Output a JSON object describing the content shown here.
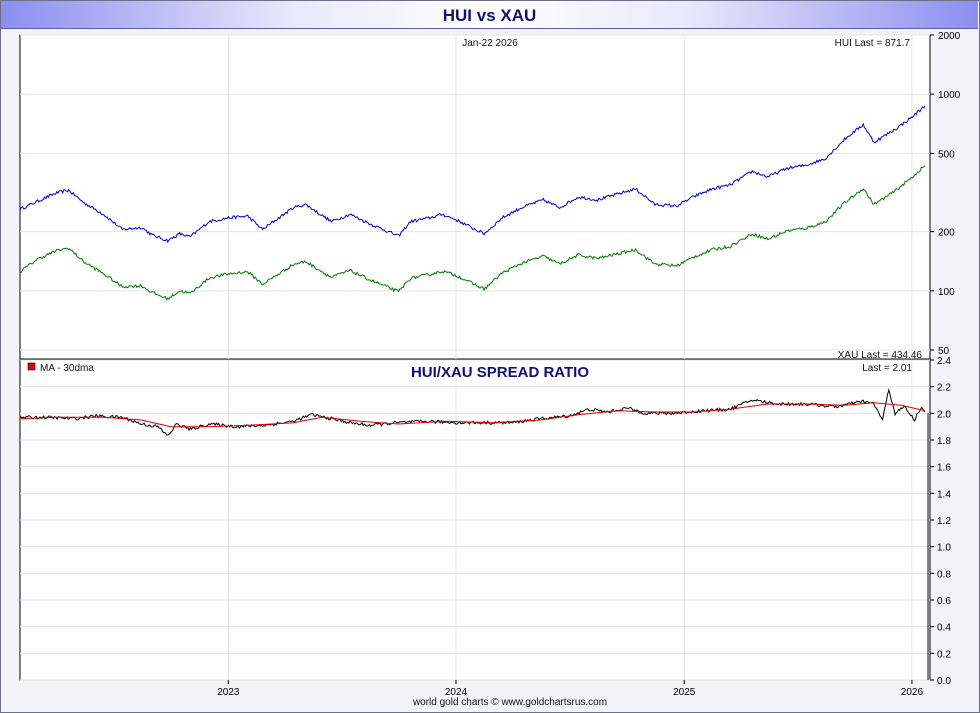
{
  "window": {
    "title": "HUI vs XAU"
  },
  "footer": {
    "credit": "world gold charts © www.goldchartsrus.com"
  },
  "chart_data": [
    {
      "type": "line",
      "panel": "top",
      "date_label": "Jan-22  2026",
      "hui_last_label": "HUI Last = 871.7",
      "xau_last_label": "XAU Last = 434.46",
      "y_scale": "log",
      "ylim": [
        45,
        2000
      ],
      "y_ticks": [
        50,
        100,
        200,
        500,
        1000,
        2000
      ],
      "y_tick_labels": [
        "50",
        "100",
        "200",
        "500",
        "1000",
        "2000"
      ],
      "x_tick_labels": [
        "2023",
        "2024",
        "2025",
        "2026"
      ],
      "series": [
        {
          "name": "HUI",
          "color": "#0000c8",
          "points": [
            [
              "2022-02-01",
              260
            ],
            [
              "2022-03-01",
              285
            ],
            [
              "2022-04-01",
              315
            ],
            [
              "2022-04-20",
              325
            ],
            [
              "2022-05-15",
              280
            ],
            [
              "2022-06-15",
              245
            ],
            [
              "2022-07-15",
              205
            ],
            [
              "2022-08-15",
              210
            ],
            [
              "2022-09-01",
              192
            ],
            [
              "2022-09-26",
              180
            ],
            [
              "2022-10-15",
              195
            ],
            [
              "2022-11-01",
              188
            ],
            [
              "2022-12-01",
              225
            ],
            [
              "2023-01-01",
              235
            ],
            [
              "2023-02-01",
              240
            ],
            [
              "2023-02-25",
              205
            ],
            [
              "2023-04-15",
              265
            ],
            [
              "2023-05-05",
              275
            ],
            [
              "2023-06-15",
              225
            ],
            [
              "2023-07-15",
              245
            ],
            [
              "2023-08-15",
              220
            ],
            [
              "2023-10-01",
              190
            ],
            [
              "2023-10-20",
              225
            ],
            [
              "2023-11-20",
              235
            ],
            [
              "2023-12-10",
              245
            ],
            [
              "2024-01-01",
              230
            ],
            [
              "2024-02-15",
              195
            ],
            [
              "2024-03-15",
              235
            ],
            [
              "2024-04-15",
              265
            ],
            [
              "2024-05-20",
              290
            ],
            [
              "2024-06-15",
              265
            ],
            [
              "2024-07-15",
              300
            ],
            [
              "2024-08-15",
              290
            ],
            [
              "2024-10-15",
              330
            ],
            [
              "2024-11-15",
              275
            ],
            [
              "2024-12-20",
              270
            ],
            [
              "2025-01-15",
              300
            ],
            [
              "2025-02-15",
              330
            ],
            [
              "2025-03-15",
              345
            ],
            [
              "2025-04-20",
              405
            ],
            [
              "2025-05-15",
              380
            ],
            [
              "2025-06-15",
              420
            ],
            [
              "2025-07-15",
              435
            ],
            [
              "2025-08-15",
              470
            ],
            [
              "2025-09-15",
              590
            ],
            [
              "2025-10-15",
              700
            ],
            [
              "2025-11-01",
              570
            ],
            [
              "2025-12-01",
              650
            ],
            [
              "2025-12-31",
              760
            ],
            [
              "2026-01-22",
              871.7
            ]
          ]
        },
        {
          "name": "XAU",
          "color": "#007800",
          "points": [
            [
              "2022-02-01",
              125
            ],
            [
              "2022-03-01",
              145
            ],
            [
              "2022-04-01",
              160
            ],
            [
              "2022-04-20",
              165
            ],
            [
              "2022-05-15",
              140
            ],
            [
              "2022-06-15",
              122
            ],
            [
              "2022-07-15",
              105
            ],
            [
              "2022-08-15",
              106
            ],
            [
              "2022-09-01",
              98
            ],
            [
              "2022-09-26",
              91
            ],
            [
              "2022-10-15",
              100
            ],
            [
              "2022-11-01",
              97
            ],
            [
              "2022-12-01",
              116
            ],
            [
              "2023-01-01",
              122
            ],
            [
              "2023-02-01",
              125
            ],
            [
              "2023-02-25",
              108
            ],
            [
              "2023-04-15",
              136
            ],
            [
              "2023-05-05",
              141
            ],
            [
              "2023-06-15",
              117
            ],
            [
              "2023-07-15",
              127
            ],
            [
              "2023-08-15",
              114
            ],
            [
              "2023-10-01",
              99
            ],
            [
              "2023-10-20",
              116
            ],
            [
              "2023-11-20",
              121
            ],
            [
              "2023-12-10",
              126
            ],
            [
              "2024-01-01",
              120
            ],
            [
              "2024-02-15",
              102
            ],
            [
              "2024-03-15",
              123
            ],
            [
              "2024-04-15",
              138
            ],
            [
              "2024-05-20",
              150
            ],
            [
              "2024-06-15",
              137
            ],
            [
              "2024-07-15",
              152
            ],
            [
              "2024-08-15",
              146
            ],
            [
              "2024-10-15",
              162
            ],
            [
              "2024-11-15",
              137
            ],
            [
              "2024-12-20",
              134
            ],
            [
              "2025-01-15",
              148
            ],
            [
              "2025-02-15",
              162
            ],
            [
              "2025-03-15",
              168
            ],
            [
              "2025-04-20",
              195
            ],
            [
              "2025-05-15",
              183
            ],
            [
              "2025-06-15",
              202
            ],
            [
              "2025-07-15",
              208
            ],
            [
              "2025-08-15",
              224
            ],
            [
              "2025-09-15",
              280
            ],
            [
              "2025-10-15",
              332
            ],
            [
              "2025-11-01",
              275
            ],
            [
              "2025-12-01",
              315
            ],
            [
              "2025-12-31",
              375
            ],
            [
              "2026-01-22",
              434.46
            ]
          ]
        }
      ]
    },
    {
      "type": "line",
      "panel": "bottom",
      "title": "HUI/XAU SPREAD RATIO",
      "legend": "MA - 30dma",
      "last_label": "Last = 2.01",
      "ylim": [
        0,
        2.4
      ],
      "y_ticks": [
        0.0,
        0.2,
        0.4,
        0.6,
        0.8,
        1.0,
        1.2,
        1.4,
        1.6,
        1.8,
        2.0,
        2.2,
        2.4
      ],
      "y_tick_labels": [
        "0.0",
        "0.2",
        "0.4",
        "0.6",
        "0.8",
        "1.0",
        "1.2",
        "1.4",
        "1.6",
        "1.8",
        "2.0",
        "2.2",
        "2.4"
      ],
      "series": [
        {
          "name": "HUI/XAU",
          "color": "#000000",
          "points": [
            [
              "2022-02-01",
              1.97
            ],
            [
              "2022-03-15",
              1.97
            ],
            [
              "2022-05-01",
              1.96
            ],
            [
              "2022-06-01",
              1.98
            ],
            [
              "2022-07-15",
              1.97
            ],
            [
              "2022-08-15",
              1.92
            ],
            [
              "2022-09-10",
              1.9
            ],
            [
              "2022-09-26",
              1.83
            ],
            [
              "2022-10-10",
              1.92
            ],
            [
              "2022-11-01",
              1.88
            ],
            [
              "2022-12-01",
              1.92
            ],
            [
              "2023-01-15",
              1.9
            ],
            [
              "2023-03-01",
              1.91
            ],
            [
              "2023-04-15",
              1.94
            ],
            [
              "2023-05-15",
              1.99
            ],
            [
              "2023-06-15",
              1.96
            ],
            [
              "2023-07-15",
              1.93
            ],
            [
              "2023-08-15",
              1.91
            ],
            [
              "2023-10-01",
              1.93
            ],
            [
              "2023-11-15",
              1.94
            ],
            [
              "2024-01-01",
              1.93
            ],
            [
              "2024-02-15",
              1.93
            ],
            [
              "2024-04-01",
              1.93
            ],
            [
              "2024-05-15",
              1.96
            ],
            [
              "2024-07-01",
              1.98
            ],
            [
              "2024-08-01",
              2.03
            ],
            [
              "2024-09-01",
              2.01
            ],
            [
              "2024-10-01",
              2.04
            ],
            [
              "2024-11-01",
              2.0
            ],
            [
              "2024-12-15",
              2.0
            ],
            [
              "2025-02-01",
              2.02
            ],
            [
              "2025-03-15",
              2.03
            ],
            [
              "2025-04-20",
              2.1
            ],
            [
              "2025-06-01",
              2.07
            ],
            [
              "2025-07-15",
              2.07
            ],
            [
              "2025-09-01",
              2.05
            ],
            [
              "2025-10-15",
              2.09
            ],
            [
              "2025-11-01",
              2.07
            ],
            [
              "2025-11-15",
              1.95
            ],
            [
              "2025-11-25",
              2.18
            ],
            [
              "2025-12-05",
              2.0
            ],
            [
              "2025-12-20",
              2.05
            ],
            [
              "2026-01-05",
              1.95
            ],
            [
              "2026-01-15",
              2.04
            ],
            [
              "2026-01-22",
              2.01
            ]
          ]
        },
        {
          "name": "MA - 30dma",
          "color": "#e00000",
          "points": [
            [
              "2022-02-01",
              1.96
            ],
            [
              "2022-04-01",
              1.97
            ],
            [
              "2022-06-15",
              1.97
            ],
            [
              "2022-08-15",
              1.95
            ],
            [
              "2022-10-01",
              1.9
            ],
            [
              "2022-12-01",
              1.9
            ],
            [
              "2023-02-01",
              1.91
            ],
            [
              "2023-04-15",
              1.93
            ],
            [
              "2023-06-01",
              1.97
            ],
            [
              "2023-08-01",
              1.94
            ],
            [
              "2023-10-01",
              1.92
            ],
            [
              "2023-12-15",
              1.94
            ],
            [
              "2024-03-01",
              1.93
            ],
            [
              "2024-05-15",
              1.95
            ],
            [
              "2024-07-15",
              1.99
            ],
            [
              "2024-09-15",
              2.02
            ],
            [
              "2024-11-15",
              2.01
            ],
            [
              "2025-01-15",
              2.01
            ],
            [
              "2025-03-15",
              2.03
            ],
            [
              "2025-05-15",
              2.07
            ],
            [
              "2025-07-15",
              2.07
            ],
            [
              "2025-09-15",
              2.06
            ],
            [
              "2025-11-01",
              2.08
            ],
            [
              "2025-12-15",
              2.06
            ],
            [
              "2026-01-22",
              2.02
            ]
          ]
        }
      ]
    }
  ]
}
